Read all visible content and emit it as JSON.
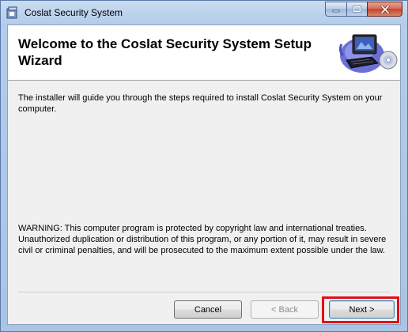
{
  "window": {
    "title": "Coslat Security System",
    "icon": "installer-icon",
    "controls": {
      "minimize_icon": "minimize-icon",
      "maximize_icon": "maximize-icon",
      "close_icon": "close-icon"
    }
  },
  "banner": {
    "title": "Welcome to the Coslat Security System Setup Wizard",
    "art": "computer-with-disc-icon"
  },
  "main": {
    "intro": "The installer will guide you through the steps required to install Coslat Security System on your computer.",
    "warning": "WARNING: This computer program is protected by copyright law and international treaties. Unauthorized duplication or distribution of this program, or any portion of it, may result in severe civil or criminal penalties, and will be prosecuted to the maximum extent possible under the law."
  },
  "buttons": {
    "cancel_label": "Cancel",
    "back_label": "< Back",
    "next_label": "Next >"
  },
  "colors": {
    "highlight": "#e0101a",
    "title_bar": "#b3cce9"
  }
}
